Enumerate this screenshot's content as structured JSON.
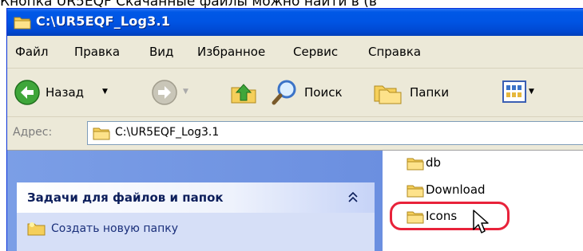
{
  "overlay_text": "Кнопка UR5EQF Скачанные файлы можно найти в (в",
  "window": {
    "title": "C:\\UR5EQF_Log3.1"
  },
  "menu": [
    "Файл",
    "Правка",
    "Вид",
    "Избранное",
    "Сервис",
    "Справка"
  ],
  "toolbar": {
    "back_label": "Назад",
    "search_label": "Поиск",
    "folders_label": "Папки"
  },
  "address": {
    "label": "Адрес:",
    "value": "C:\\UR5EQF_Log3.1"
  },
  "tasks": {
    "header": "Задачи для файлов и папок",
    "items": [
      "Создать новую папку"
    ]
  },
  "files": [
    {
      "name": "db"
    },
    {
      "name": "Download"
    },
    {
      "name": "Icons"
    }
  ],
  "colors": {
    "titlebar": "#0054e3",
    "highlight": "#e8223a",
    "taskpane": "#7b9ee6"
  }
}
